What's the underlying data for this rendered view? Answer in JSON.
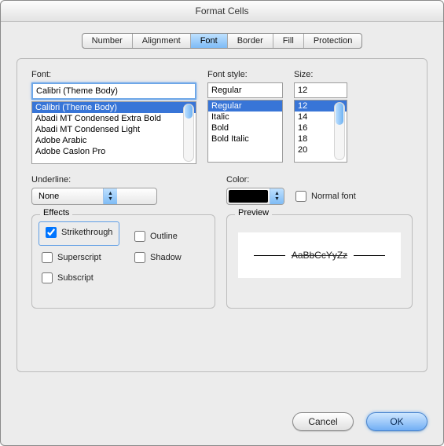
{
  "title": "Format Cells",
  "tabs": [
    {
      "label": "Number",
      "active": false
    },
    {
      "label": "Alignment",
      "active": false
    },
    {
      "label": "Font",
      "active": true
    },
    {
      "label": "Border",
      "active": false
    },
    {
      "label": "Fill",
      "active": false
    },
    {
      "label": "Protection",
      "active": false
    }
  ],
  "font": {
    "label": "Font:",
    "value": "Calibri (Theme Body)",
    "list": [
      "Calibri (Theme Body)",
      "Abadi MT Condensed Extra Bold",
      "Abadi MT Condensed Light",
      "Adobe Arabic",
      "Adobe Caslon Pro"
    ],
    "selected_index": 0
  },
  "style": {
    "label": "Font style:",
    "value": "Regular",
    "list": [
      "Regular",
      "Italic",
      "Bold",
      "Bold Italic"
    ],
    "selected_index": 0
  },
  "size": {
    "label": "Size:",
    "value": "12",
    "list": [
      "12",
      "14",
      "16",
      "18",
      "20"
    ],
    "selected_index": 0
  },
  "underline": {
    "label": "Underline:",
    "value": "None"
  },
  "color": {
    "label": "Color:",
    "swatch_hex": "#000000"
  },
  "normal_font": {
    "label": "Normal font",
    "checked": false
  },
  "effects": {
    "legend": "Effects",
    "strikethrough": {
      "label": "Strikethrough",
      "checked": true
    },
    "superscript": {
      "label": "Superscript",
      "checked": false
    },
    "subscript": {
      "label": "Subscript",
      "checked": false
    },
    "outline": {
      "label": "Outline",
      "checked": false
    },
    "shadow": {
      "label": "Shadow",
      "checked": false
    }
  },
  "preview": {
    "legend": "Preview",
    "text": "AaBbCcYyZz"
  },
  "buttons": {
    "cancel": "Cancel",
    "ok": "OK"
  }
}
